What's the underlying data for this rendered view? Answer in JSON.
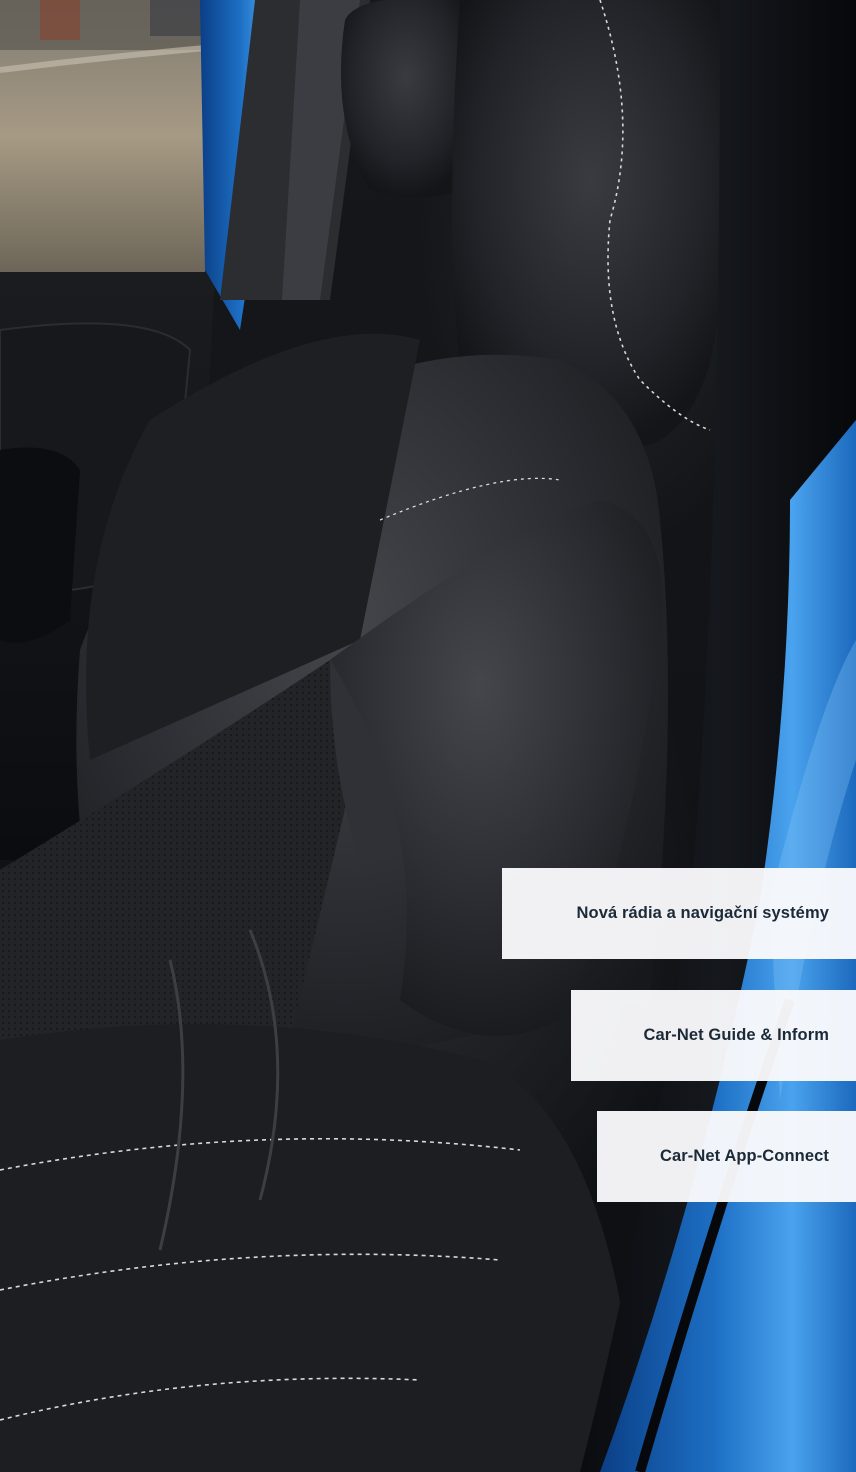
{
  "menu": {
    "items": [
      {
        "label": "Nová rádia a navigační systémy"
      },
      {
        "label": "Car-Net Guide & Inform"
      },
      {
        "label": "Car-Net App-Connect"
      }
    ]
  },
  "colors": {
    "car_body_blue": "#1d6fc4",
    "seat_leather": "#232428",
    "stitching": "#d9d9d9",
    "button_bg": "#f8f8fa",
    "button_text": "#1c2a38"
  }
}
